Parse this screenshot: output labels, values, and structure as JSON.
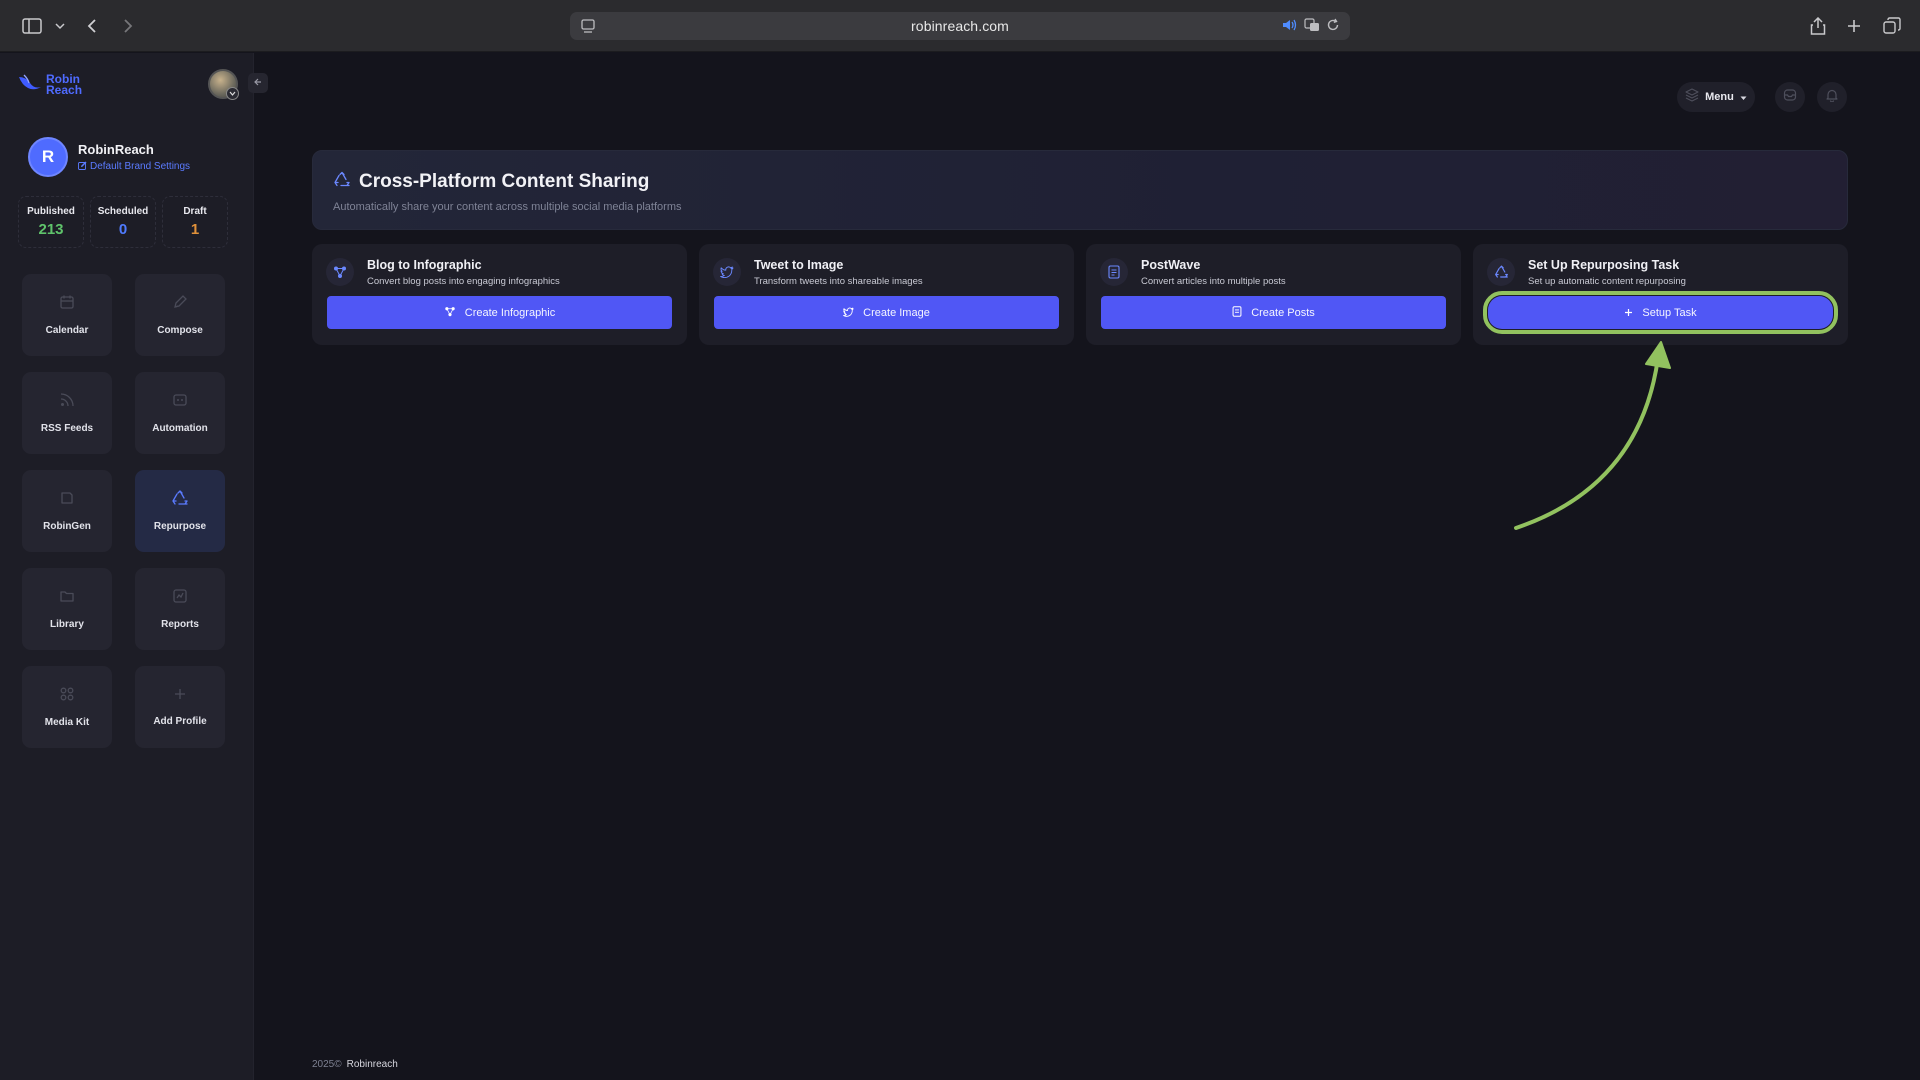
{
  "browser": {
    "url": "robinreach.com"
  },
  "sidebar": {
    "logo_line1": "Robin",
    "logo_line2": "Reach",
    "profile": {
      "initial": "R",
      "name": "RobinReach",
      "settings_link": "Default Brand Settings"
    },
    "stats": [
      {
        "label": "Published",
        "value": "213",
        "color": "#5fc36b"
      },
      {
        "label": "Scheduled",
        "value": "0",
        "color": "#4f7bff"
      },
      {
        "label": "Draft",
        "value": "1",
        "color": "#e0913a"
      }
    ],
    "nav": [
      {
        "label": "Calendar",
        "icon": "calendar-icon"
      },
      {
        "label": "Compose",
        "icon": "compose-icon"
      },
      {
        "label": "RSS Feeds",
        "icon": "rss-icon"
      },
      {
        "label": "Automation",
        "icon": "automation-icon"
      },
      {
        "label": "RobinGen",
        "icon": "robingen-icon"
      },
      {
        "label": "Repurpose",
        "icon": "recycle-icon"
      },
      {
        "label": "Library",
        "icon": "folder-icon"
      },
      {
        "label": "Reports",
        "icon": "chart-icon"
      },
      {
        "label": "Media Kit",
        "icon": "grid-icon"
      },
      {
        "label": "Add Profile",
        "icon": "plus-icon"
      }
    ]
  },
  "header": {
    "menu_label": "Menu"
  },
  "hero": {
    "title": "Cross-Platform Content Sharing",
    "subtitle": "Automatically share your content across multiple social media platforms"
  },
  "cards": [
    {
      "title": "Blog to Infographic",
      "subtitle": "Convert blog posts into engaging infographics",
      "button": "Create Infographic"
    },
    {
      "title": "Tweet to Image",
      "subtitle": "Transform tweets into shareable images",
      "button": "Create Image"
    },
    {
      "title": "PostWave",
      "subtitle": "Convert articles into multiple posts",
      "button": "Create Posts"
    },
    {
      "title": "Set Up Repurposing Task",
      "subtitle": "Set up automatic content repurposing",
      "button": "Setup Task"
    }
  ],
  "footer": {
    "year": "2025©",
    "brand": "Robinreach"
  },
  "colors": {
    "accent": "#5057f5",
    "highlight": "#92c25f"
  }
}
